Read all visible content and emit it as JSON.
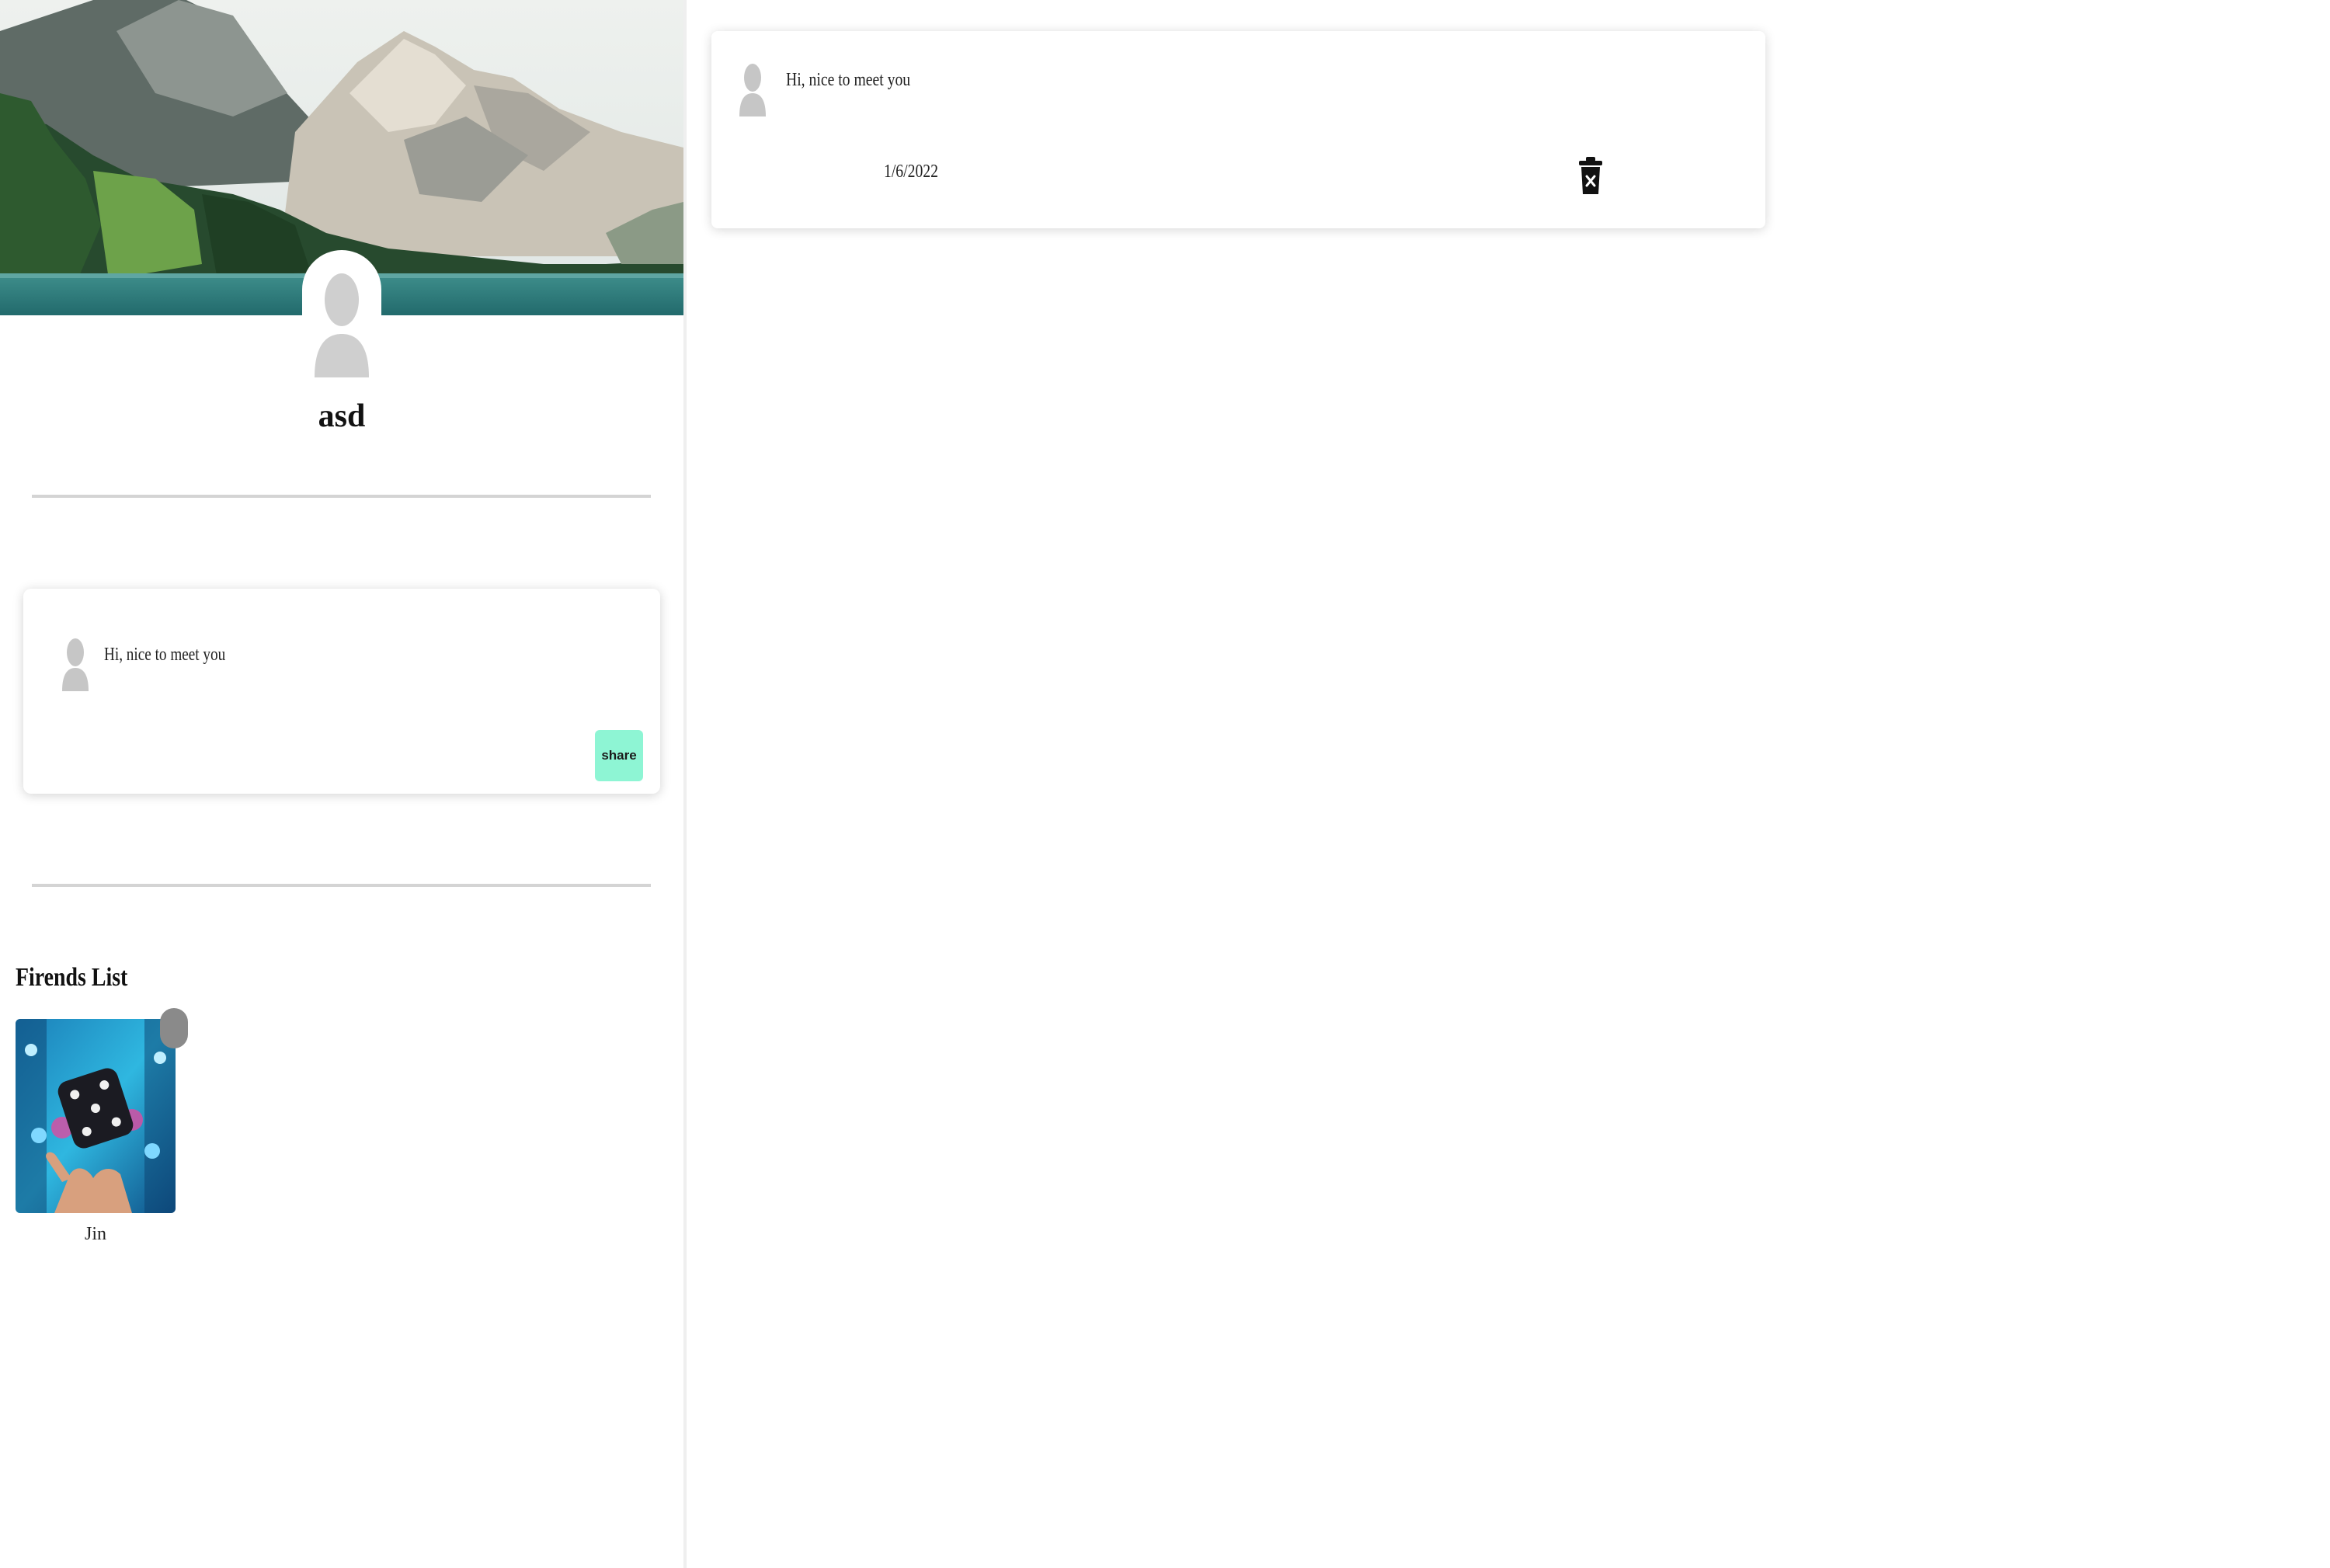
{
  "profile": {
    "name": "asd",
    "cover_image": "mountain-lake-landscape",
    "avatar_icon": "default-user-silhouette"
  },
  "composer": {
    "text": "Hi, nice to meet you",
    "avatar_icon": "default-user-silhouette",
    "share_label": "share",
    "share_color": "#8ef5d4"
  },
  "friends": {
    "title": "Firends List",
    "items": [
      {
        "name": "Jin",
        "photo": "hand-tossing-dice-neon",
        "status_color": "#8a8a8a"
      }
    ]
  },
  "feed": {
    "posts": [
      {
        "text": "Hi, nice to meet you",
        "date": "1/6/2022",
        "avatar_icon": "default-user-silhouette",
        "delete_icon": "trash-icon"
      }
    ]
  }
}
